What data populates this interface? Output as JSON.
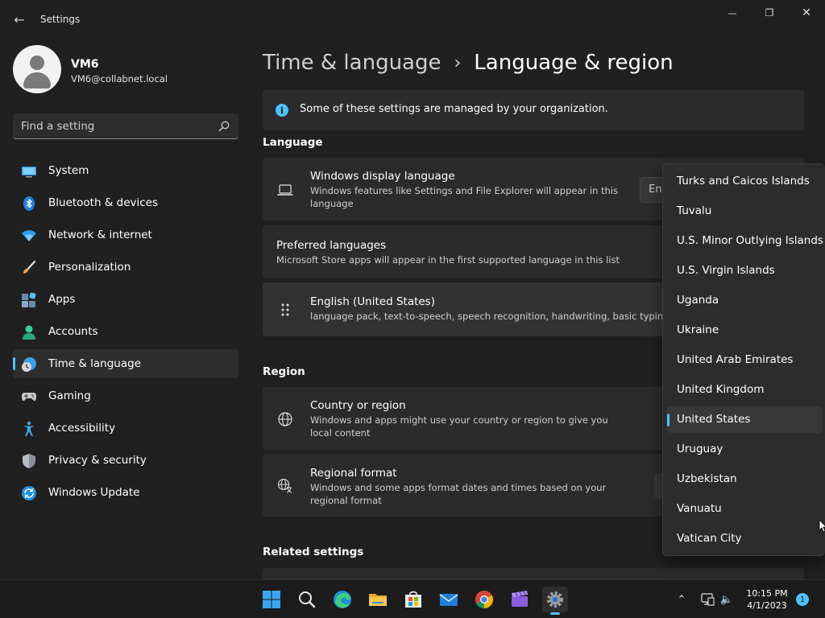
{
  "window": {
    "title": "Settings",
    "back_glyph": "←",
    "minimize_glyph": "—",
    "maximize_glyph": "❐",
    "close_glyph": "✕"
  },
  "profile": {
    "name": "VM6",
    "email": "VM6@collabnet.local"
  },
  "search": {
    "placeholder": "Find a setting"
  },
  "sidebar": {
    "items": [
      {
        "label": "System",
        "icon": "system-icon",
        "active": false
      },
      {
        "label": "Bluetooth & devices",
        "icon": "bluetooth-icon",
        "active": false
      },
      {
        "label": "Network & internet",
        "icon": "wifi-icon",
        "active": false
      },
      {
        "label": "Personalization",
        "icon": "brush-icon",
        "active": false
      },
      {
        "label": "Apps",
        "icon": "apps-icon",
        "active": false
      },
      {
        "label": "Accounts",
        "icon": "accounts-icon",
        "active": false
      },
      {
        "label": "Time & language",
        "icon": "time-language-icon",
        "active": true
      },
      {
        "label": "Gaming",
        "icon": "gamepad-icon",
        "active": false
      },
      {
        "label": "Accessibility",
        "icon": "accessibility-icon",
        "active": false
      },
      {
        "label": "Privacy & security",
        "icon": "shield-icon",
        "active": false
      },
      {
        "label": "Windows Update",
        "icon": "update-icon",
        "active": false
      }
    ]
  },
  "breadcrumb": {
    "parent": "Time & language",
    "separator": "›",
    "current": "Language & region"
  },
  "info_bar": {
    "glyph": "i",
    "text": "Some of these settings are managed by your organization."
  },
  "language": {
    "heading": "Language",
    "display_language": {
      "title": "Windows display language",
      "description": "Windows features like Settings and File Explorer will appear in this language",
      "value_partial": "En"
    },
    "preferred": {
      "title": "Preferred languages",
      "description": "Microsoft Store apps will appear in the first supported language in this list"
    },
    "english": {
      "title": "English (United States)",
      "description": "language pack, text-to-speech, speech recognition, handwriting, basic typing"
    }
  },
  "region": {
    "heading": "Region",
    "country": {
      "title": "Country or region",
      "description": "Windows and apps might use your country or region to give you local content"
    },
    "format": {
      "title": "Regional format",
      "description": "Windows and some apps format dates and times based on your regional format"
    }
  },
  "related": {
    "heading": "Related settings"
  },
  "country_dropdown": {
    "options": [
      "Turks and Caicos Islands",
      "Tuvalu",
      "U.S. Minor Outlying Islands",
      "U.S. Virgin Islands",
      "Uganda",
      "Ukraine",
      "United Arab Emirates",
      "United Kingdom",
      "United States",
      "Uruguay",
      "Uzbekistan",
      "Vanuatu",
      "Vatican City"
    ],
    "selected": "United States"
  },
  "taskbar": {
    "apps": [
      "start-icon",
      "search-icon",
      "edge-icon",
      "file-explorer-icon",
      "store-icon",
      "mail-icon",
      "chrome-icon",
      "clapper-icon",
      "settings-icon"
    ],
    "active_app": "settings-icon",
    "tray_chevron": "⌃",
    "volume_glyph": "🔈",
    "time": "10:15 PM",
    "date": "4/1/2023",
    "notification_count": "1"
  },
  "colors": {
    "accent": "#4cc2ff",
    "background": "#202020",
    "card": "#2b2b2b"
  }
}
